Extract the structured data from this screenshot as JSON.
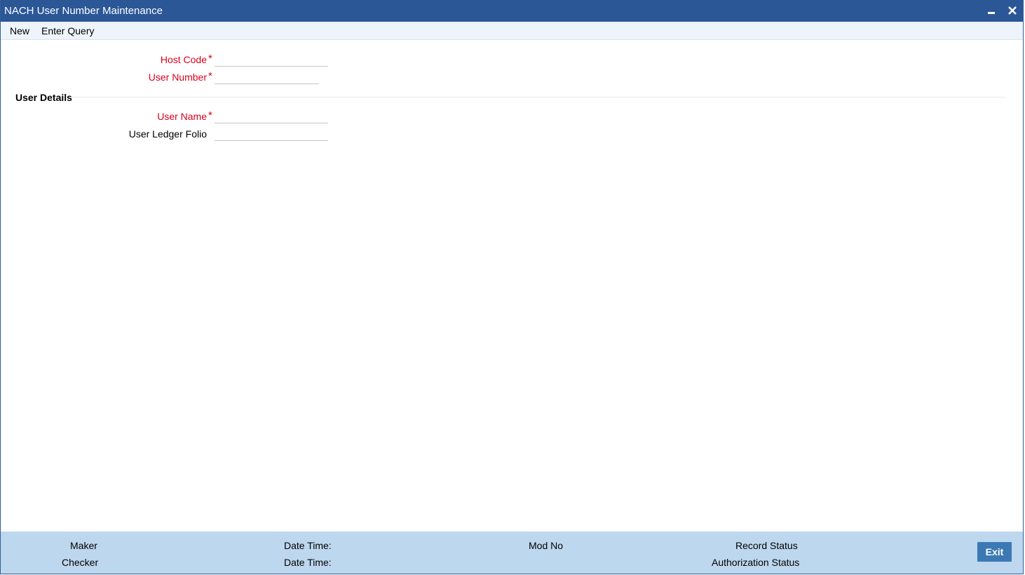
{
  "window": {
    "title": "NACH User Number Maintenance"
  },
  "toolbar": {
    "new_label": "New",
    "enter_query_label": "Enter Query"
  },
  "form": {
    "host_code": {
      "label": "Host Code",
      "required_mark": "*",
      "value": ""
    },
    "user_number": {
      "label": "User Number",
      "required_mark": "*",
      "value": ""
    },
    "user_details_section": "User Details",
    "user_name": {
      "label": "User Name",
      "required_mark": "*",
      "value": ""
    },
    "user_ledger_folio": {
      "label": "User Ledger Folio",
      "value": ""
    }
  },
  "footer": {
    "maker_label": "Maker",
    "checker_label": "Checker",
    "maker_date_time_label": "Date Time:",
    "checker_date_time_label": "Date Time:",
    "mod_no_label": "Mod No",
    "record_status_label": "Record Status",
    "authorization_status_label": "Authorization Status",
    "exit_label": "Exit"
  },
  "colors": {
    "titlebar": "#2b5797",
    "required": "#d8001d",
    "footer": "#bdd7ee",
    "exit_button": "#3c78b3"
  },
  "icons": {
    "minimize": "minimize-icon",
    "close": "close-icon"
  }
}
